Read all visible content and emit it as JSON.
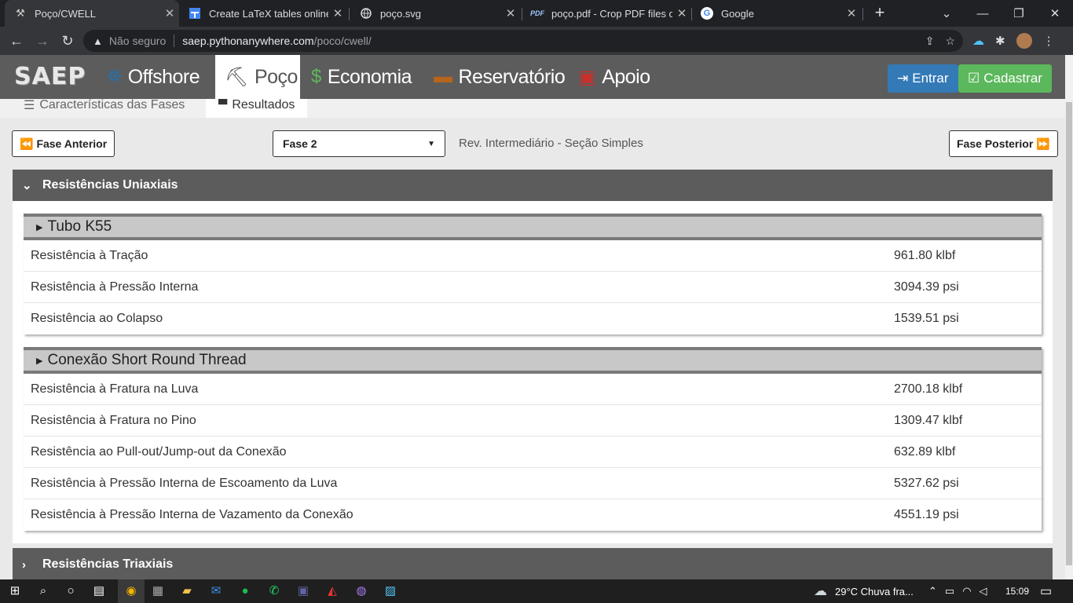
{
  "browser": {
    "tabs": [
      {
        "title": "Poço/CWELL",
        "icon": "saep-favicon",
        "active": true
      },
      {
        "title": "Create LaTeX tables online –",
        "icon": "latex-table-favicon"
      },
      {
        "title": "poço.svg",
        "icon": "globe-icon"
      },
      {
        "title": "poço.pdf - Crop PDF files onl",
        "icon": "pdf-favicon"
      },
      {
        "title": "Google",
        "icon": "google-icon"
      }
    ],
    "address": {
      "security": "Não seguro",
      "host": "saep.pythonanywhere.com",
      "path": "/poco/cwell/"
    }
  },
  "site": {
    "logo": "SAEP",
    "nav": [
      {
        "label": "Offshore",
        "icon": "offshore-icon"
      },
      {
        "label": "Poço",
        "icon": "oil-pump-icon",
        "active": true
      },
      {
        "label": "Economia",
        "icon": "dollar-icon"
      },
      {
        "label": "Reservatório",
        "icon": "reservoir-icon"
      },
      {
        "label": "Apoio",
        "icon": "support-icon"
      }
    ],
    "login_label": "Entrar",
    "register_label": "Cadastrar",
    "colors": {
      "login": "#337ab7",
      "register": "#5cb85c",
      "header": "#5c5c5c"
    }
  },
  "subtabs": {
    "characteristics": "Características das Fases",
    "results": "Resultados"
  },
  "phase_nav": {
    "prev_label": "Fase Anterior",
    "next_label": "Fase Posterior",
    "selected_phase": "Fase 2",
    "phase_description": "Rev. Intermediário - Seção Simples"
  },
  "uniaxial": {
    "title": "Resistências Uniaxiais",
    "groups": [
      {
        "title": "Tubo K55",
        "rows": [
          {
            "label": "Resistência à Tração",
            "value": "961.80 klbf"
          },
          {
            "label": "Resistência à Pressão Interna",
            "value": "3094.39 psi"
          },
          {
            "label": "Resistência ao Colapso",
            "value": "1539.51 psi"
          }
        ]
      },
      {
        "title": "Conexão Short Round Thread",
        "rows": [
          {
            "label": "Resistência à Fratura na Luva",
            "value": "2700.18 klbf"
          },
          {
            "label": "Resistência à Fratura no Pino",
            "value": "1309.47 klbf"
          },
          {
            "label": "Resistência ao Pull-out/Jump-out da Conexão",
            "value": "632.89 klbf"
          },
          {
            "label": "Resistência à Pressão Interna de Escoamento da Luva",
            "value": "5327.62 psi"
          },
          {
            "label": "Resistência à Pressão Interna de Vazamento da Conexão",
            "value": "4551.19 psi"
          }
        ]
      }
    ]
  },
  "triaxial": {
    "title": "Resistências Triaxiais"
  },
  "taskbar": {
    "weather": "29°C  Chuva fra...",
    "time": "15:09"
  }
}
